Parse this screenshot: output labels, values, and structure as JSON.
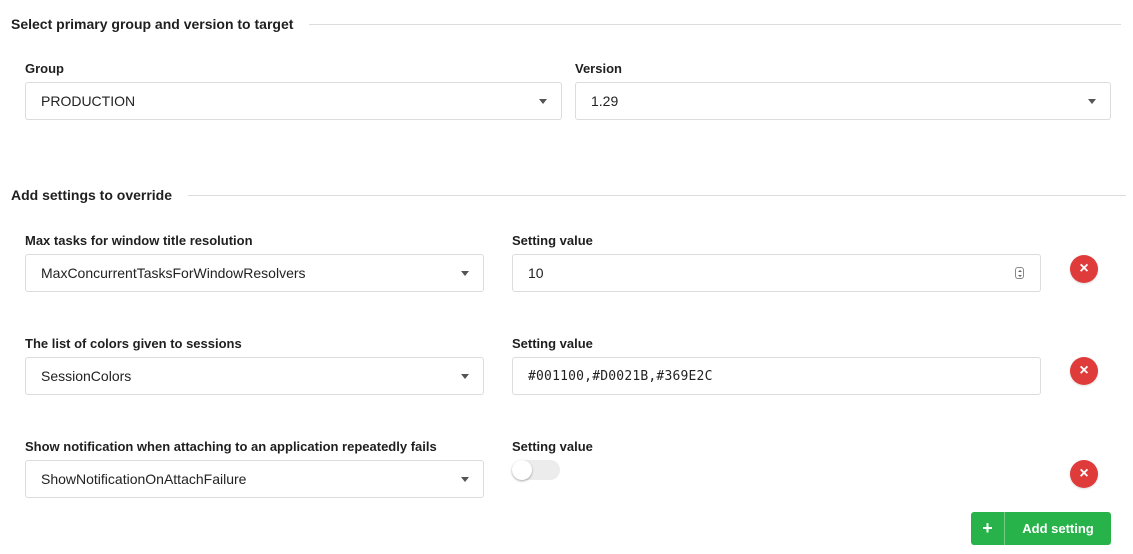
{
  "target": {
    "heading": "Select primary group and version to target",
    "group_label": "Group",
    "group_value": "PRODUCTION",
    "version_label": "Version",
    "version_value": "1.29"
  },
  "overrides": {
    "heading": "Add settings to override",
    "rows": [
      {
        "description": "Max tasks for window title resolution",
        "setting": "MaxConcurrentTasksForWindowResolvers",
        "value_label": "Setting value",
        "value": "10",
        "value_type": "number"
      },
      {
        "description": "The list of colors given to sessions",
        "setting": "SessionColors",
        "value_label": "Setting value",
        "value": "#001100,#D0021B,#369E2C",
        "value_type": "text"
      },
      {
        "description": "Show notification when attaching to an application repeatedly fails",
        "setting": "ShowNotificationOnAttachFailure",
        "value_label": "Setting value",
        "value": false,
        "value_type": "toggle"
      }
    ],
    "remove_symbol": "×",
    "add_button": {
      "icon": "+",
      "label": "Add setting"
    }
  },
  "colors": {
    "remove": "#e03b3b",
    "add": "#27b24a"
  }
}
